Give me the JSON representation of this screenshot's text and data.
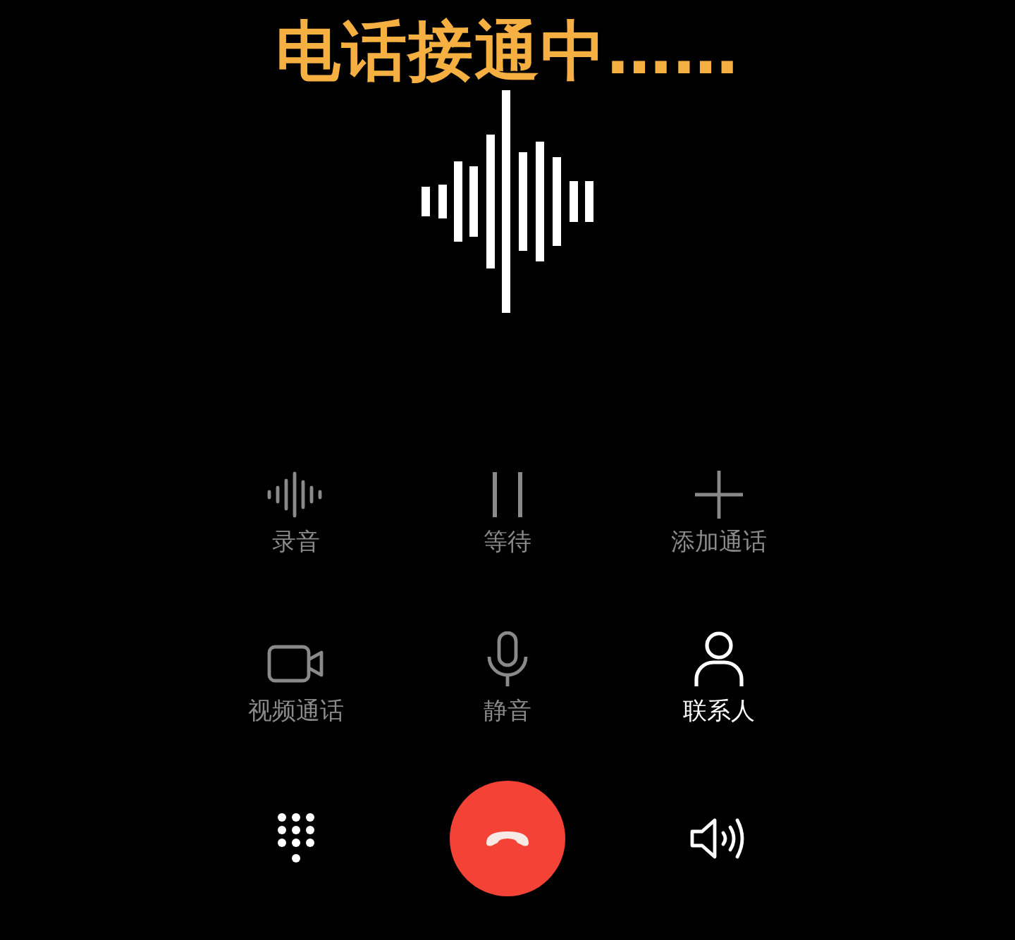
{
  "title": "电话接通中……",
  "actions": [
    {
      "kind": "record",
      "label": "录音",
      "disabled": true
    },
    {
      "kind": "hold",
      "label": "等待",
      "disabled": true
    },
    {
      "kind": "add",
      "label": "添加通话",
      "disabled": true
    },
    {
      "kind": "video",
      "label": "视频通话",
      "disabled": true
    },
    {
      "kind": "mute",
      "label": "静音",
      "disabled": true
    },
    {
      "kind": "contacts",
      "label": "联系人",
      "disabled": false
    }
  ]
}
